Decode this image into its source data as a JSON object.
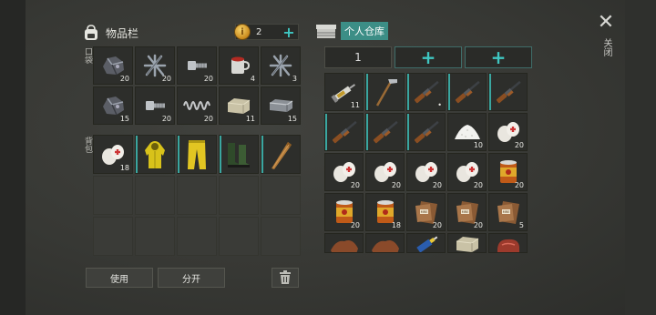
{
  "inventory": {
    "title": "物品栏",
    "pocket_label": "口袋",
    "backpack_label": "背包",
    "pockets": [
      {
        "item": "ore-icon",
        "qty": "20"
      },
      {
        "item": "iron-nails-icon",
        "qty": "20"
      },
      {
        "item": "bolt-icon",
        "qty": "20"
      },
      {
        "item": "red-cup-icon",
        "qty": "4"
      },
      {
        "item": "iron-nails-icon",
        "qty": "3"
      },
      {
        "item": "ore-icon",
        "qty": "15"
      },
      {
        "item": "bolt-icon",
        "qty": "20"
      },
      {
        "item": "spring-icon",
        "qty": "20"
      },
      {
        "item": "stone-block-icon",
        "qty": "11"
      },
      {
        "item": "metal-bar-icon",
        "qty": "15"
      }
    ],
    "backpack": [
      {
        "item": "bandage-icon",
        "qty": "18"
      },
      {
        "item": "raincoat-icon",
        "qty": ""
      },
      {
        "item": "yellow-pants-icon",
        "qty": ""
      },
      {
        "item": "green-boots-icon",
        "qty": ""
      },
      {
        "item": "wooden-club-icon",
        "qty": ""
      }
    ]
  },
  "coins": {
    "count": "2"
  },
  "storage": {
    "title": "个人仓库",
    "page": "1",
    "items": [
      {
        "item": "syringe-icon",
        "qty": "11"
      },
      {
        "item": "hoe-icon",
        "qty": ""
      },
      {
        "item": "shotgun-icon",
        "qty": "•"
      },
      {
        "item": "shotgun-icon",
        "qty": ""
      },
      {
        "item": "shotgun-icon",
        "qty": ""
      },
      {
        "item": "shotgun-icon",
        "qty": ""
      },
      {
        "item": "shotgun-icon",
        "qty": ""
      },
      {
        "item": "shotgun-icon",
        "qty": ""
      },
      {
        "item": "salt-pile-icon",
        "qty": "10"
      },
      {
        "item": "bandage-icon",
        "qty": "20"
      },
      {
        "item": "bandage-icon",
        "qty": "20"
      },
      {
        "item": "bandage-icon",
        "qty": "20"
      },
      {
        "item": "bandage-icon",
        "qty": "20"
      },
      {
        "item": "bandage-icon",
        "qty": "20"
      },
      {
        "item": "canned-food-icon",
        "qty": "20"
      },
      {
        "item": "canned-food-icon",
        "qty": "20"
      },
      {
        "item": "canned-food-icon",
        "qty": "18"
      },
      {
        "item": "mre-pack-icon",
        "qty": "20"
      },
      {
        "item": "mre-pack-icon",
        "qty": "20"
      },
      {
        "item": "mre-pack-icon",
        "qty": "5"
      },
      {
        "item": "leather-icon",
        "qty": ""
      },
      {
        "item": "leather-icon",
        "qty": ""
      },
      {
        "item": "glue-tube-icon",
        "qty": ""
      },
      {
        "item": "stone-block-icon",
        "qty": ""
      },
      {
        "item": "raw-meat-icon",
        "qty": ""
      }
    ]
  },
  "buttons": {
    "use": "使用",
    "split": "分开",
    "close": "关闭"
  },
  "colors": {
    "accent": "#3fc7c2",
    "storage_tag": "#3c8e86"
  }
}
